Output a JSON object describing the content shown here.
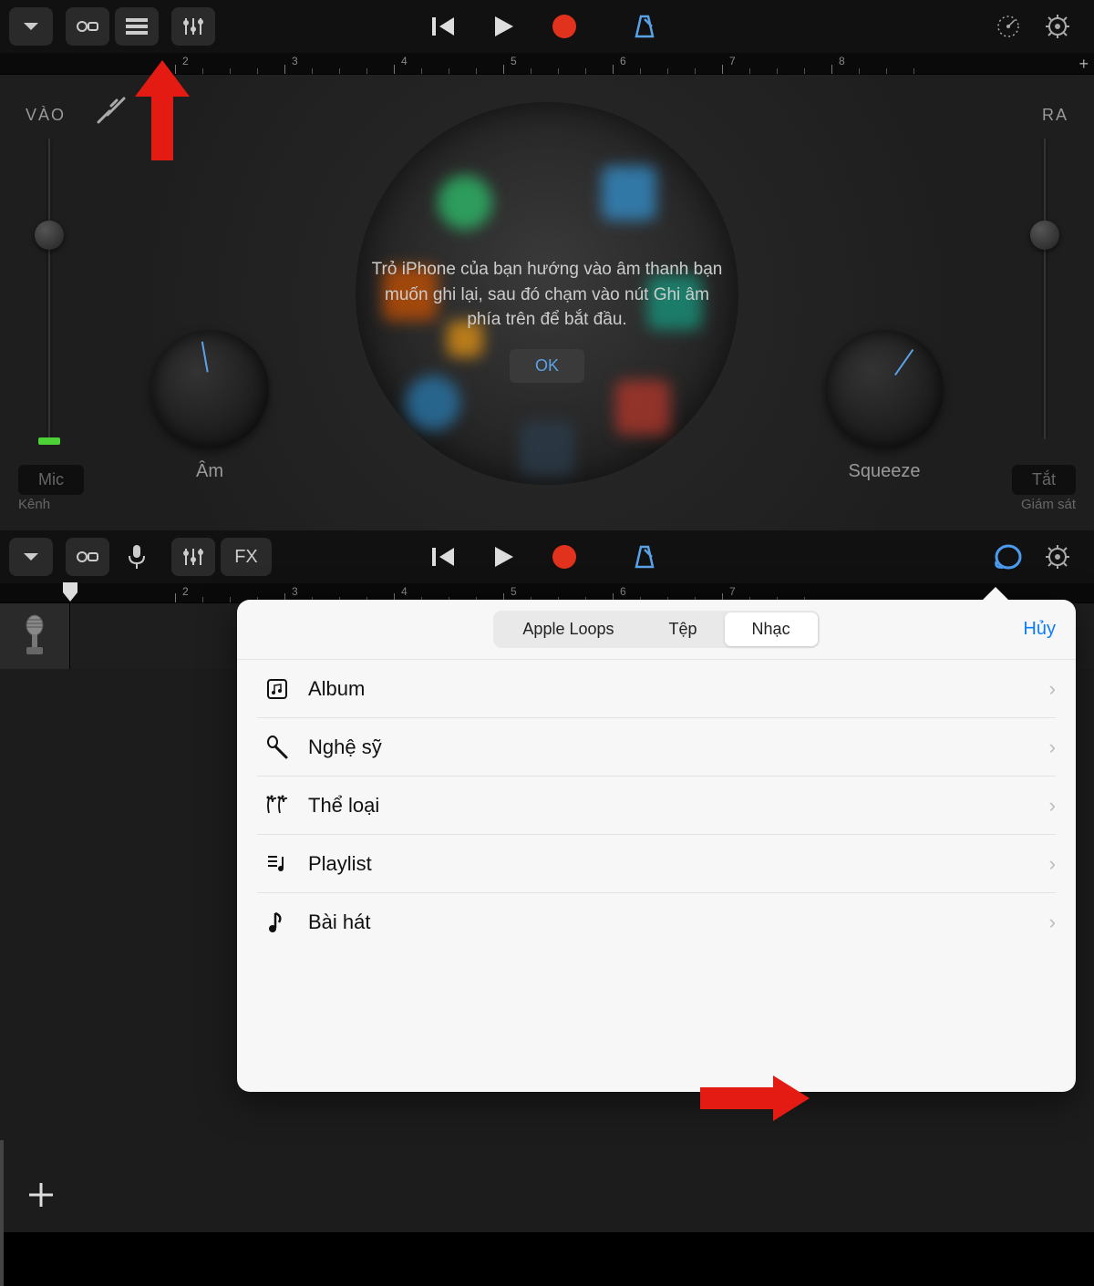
{
  "toolbarTop": {
    "ruler_markers": [
      "2",
      "3",
      "4",
      "5",
      "6",
      "7",
      "8"
    ]
  },
  "mainTop": {
    "label_vao": "VÀO",
    "label_ra": "RA",
    "knob_am": "Âm",
    "knob_sq": "Squeeze",
    "tip_text": "Trỏ iPhone của bạn hướng vào âm thanh bạn muốn ghi lại, sau đó chạm vào nút Ghi âm phía trên để bắt đầu.",
    "ok": "OK",
    "mic": "Mic",
    "kenh": "Kênh",
    "tat": "Tắt",
    "giam_sat": "Giám sát"
  },
  "toolbarBottom": {
    "fx": "FX",
    "ruler_markers": [
      "2",
      "3",
      "4",
      "5",
      "6",
      "7"
    ]
  },
  "popover": {
    "segments": [
      "Apple Loops",
      "Tệp",
      "Nhạc"
    ],
    "active_index": 2,
    "cancel": "Hủy",
    "rows": [
      "Album",
      "Nghệ sỹ",
      "Thể loại",
      "Playlist",
      "Bài hát"
    ]
  },
  "colors": {
    "accent_blue": "#5aa3e8",
    "record_red": "#e0321d",
    "arrow_red": "#e31b12",
    "ios_blue": "#0a7cff"
  }
}
